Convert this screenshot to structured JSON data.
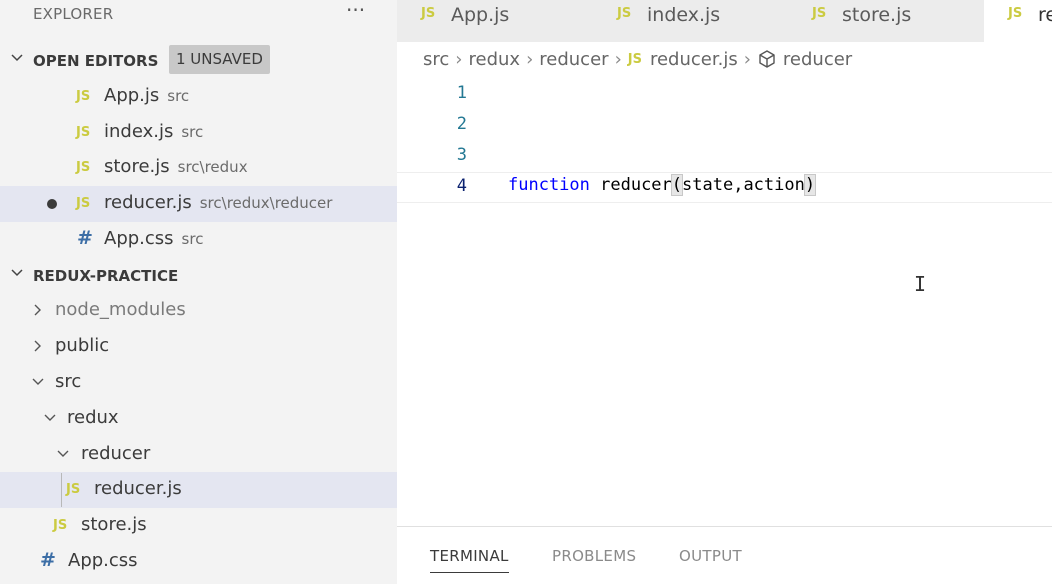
{
  "explorer": {
    "title": "EXPLORER",
    "more": "···",
    "open_editors": {
      "title": "OPEN EDITORS",
      "badge": "1 UNSAVED",
      "items": [
        {
          "icon": "JS",
          "name": "App.js",
          "path": "src"
        },
        {
          "icon": "JS",
          "name": "index.js",
          "path": "src"
        },
        {
          "icon": "JS",
          "name": "store.js",
          "path": "src\\redux"
        },
        {
          "icon": "JS",
          "name": "reducer.js",
          "path": "src\\redux\\reducer",
          "unsaved": true
        },
        {
          "icon": "#",
          "name": "App.css",
          "path": "src"
        }
      ]
    },
    "project": {
      "title": "REDUX-PRACTICE",
      "tree": [
        {
          "label": "node_modules"
        },
        {
          "label": "public"
        },
        {
          "label": "src"
        },
        {
          "label": "redux"
        },
        {
          "label": "reducer"
        },
        {
          "icon": "JS",
          "label": "reducer.js"
        },
        {
          "icon": "JS",
          "label": "store.js"
        },
        {
          "icon": "#",
          "label": "App.css"
        }
      ]
    }
  },
  "tabs": [
    {
      "icon": "JS",
      "label": "App.js"
    },
    {
      "icon": "JS",
      "label": "index.js"
    },
    {
      "icon": "JS",
      "label": "store.js"
    },
    {
      "icon": "JS",
      "label": "re"
    }
  ],
  "breadcrumb": [
    "src",
    "redux",
    "reducer",
    "reducer.js",
    "reducer"
  ],
  "breadcrumb_js_icon": "JS",
  "editor": {
    "lines": [
      {
        "num": "1",
        "text": ""
      },
      {
        "num": "2",
        "text": ""
      },
      {
        "num": "3",
        "text": ""
      },
      {
        "num": "4",
        "keyword": "function",
        "text": " reducer",
        "paren_open": "(",
        "args": "state,action",
        "paren_close": ")"
      }
    ],
    "cursor_glyph": "I"
  },
  "panel": {
    "tabs": [
      "TERMINAL",
      "PROBLEMS",
      "OUTPUT"
    ]
  },
  "colors": {
    "js_icon": "#cbcb41",
    "css_icon": "#3c6ea6",
    "keyword": "#0000ff",
    "line_number": "#237893"
  }
}
